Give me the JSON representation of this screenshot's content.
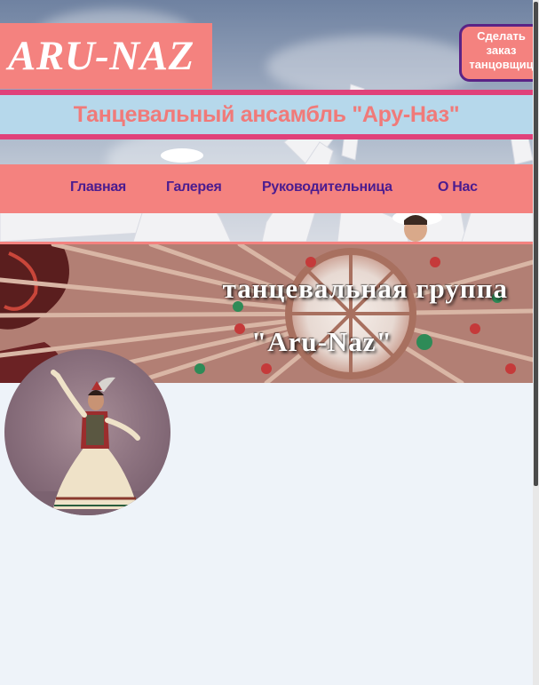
{
  "site": {
    "logo_text": "ARU-NAZ",
    "order_button": "Сделать заказ танцовщиц",
    "subtitle": "Танцевальный ансамбль \"Ару-Наз\""
  },
  "nav": {
    "items": [
      {
        "label": "Главная"
      },
      {
        "label": "Галерея"
      },
      {
        "label": "Руководительница"
      },
      {
        "label": "О Нас"
      }
    ]
  },
  "banner": {
    "line1": "танцевальная группа",
    "line2": "\"Aru-Naz\""
  },
  "colors": {
    "accent": "#f4827f",
    "nav_text": "#4b1c8f",
    "band": "#e0417a",
    "subtitle_bg": "#b6d8eb",
    "button_border": "#5a2386"
  }
}
